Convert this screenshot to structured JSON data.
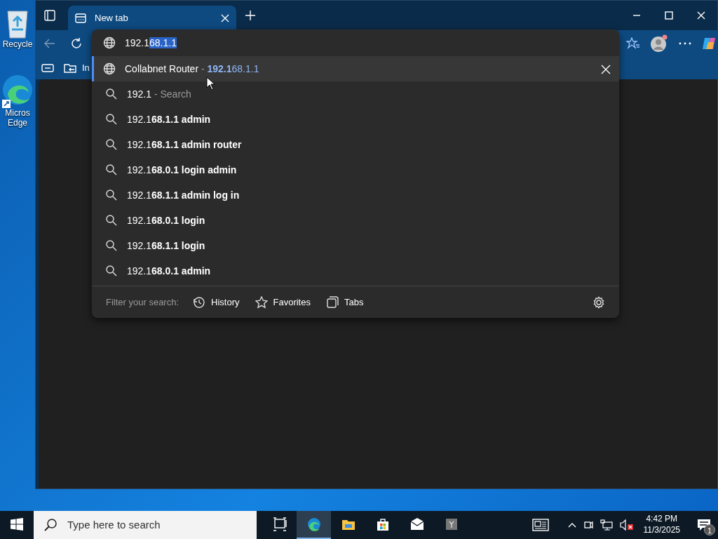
{
  "desktop_icons": [
    {
      "kind": "recycle",
      "lines": [
        "Recycle"
      ]
    },
    {
      "kind": "edge",
      "lines": [
        "Micros",
        "Edge"
      ]
    }
  ],
  "browser": {
    "tabs": [
      {
        "title": "New tab",
        "selected": true
      }
    ],
    "favorites_bar": [
      {
        "kind": "folder",
        "label": "In"
      }
    ],
    "address": {
      "typed": "192.1",
      "autocompleted": "68.1.1"
    },
    "suggestions": [
      {
        "kind": "site",
        "selected": true,
        "title": "Collabnet Router",
        "separator": " - ",
        "url": "**192.1**68.1.1"
      },
      {
        "kind": "search",
        "selected": false,
        "text": "192.1",
        "hint": " - Search"
      },
      {
        "kind": "query",
        "selected": false,
        "text": "192.1**68.1.1 admin**"
      },
      {
        "kind": "query",
        "selected": false,
        "text": "192.1**68.1.1 admin router**"
      },
      {
        "kind": "query",
        "selected": false,
        "text": "192.1**68.0.1 login admin**"
      },
      {
        "kind": "query",
        "selected": false,
        "text": "192.1**68.1.1 admin log in**"
      },
      {
        "kind": "query",
        "selected": false,
        "text": "192.1**68.0.1 login**"
      },
      {
        "kind": "query",
        "selected": false,
        "text": "192.1**68.1.1 login**"
      },
      {
        "kind": "query",
        "selected": false,
        "text": "192.1**68.0.1 admin**"
      }
    ],
    "filter_label": "Filter your search:",
    "filters": [
      {
        "kind": "history",
        "label": "History"
      },
      {
        "kind": "favorites",
        "label": "Favorites"
      },
      {
        "kind": "tabs",
        "label": "Tabs"
      }
    ]
  },
  "taskbar": {
    "search_placeholder": "Type here to search",
    "apps": [
      {
        "kind": "taskview",
        "active": false
      },
      {
        "kind": "edge",
        "active": true
      },
      {
        "kind": "explorer",
        "active": false
      },
      {
        "kind": "store",
        "active": false
      },
      {
        "kind": "mail",
        "active": false
      },
      {
        "kind": "yapp",
        "active": false
      }
    ],
    "time": "4:42 PM",
    "date": "11/3/2025",
    "notifications": "1"
  }
}
